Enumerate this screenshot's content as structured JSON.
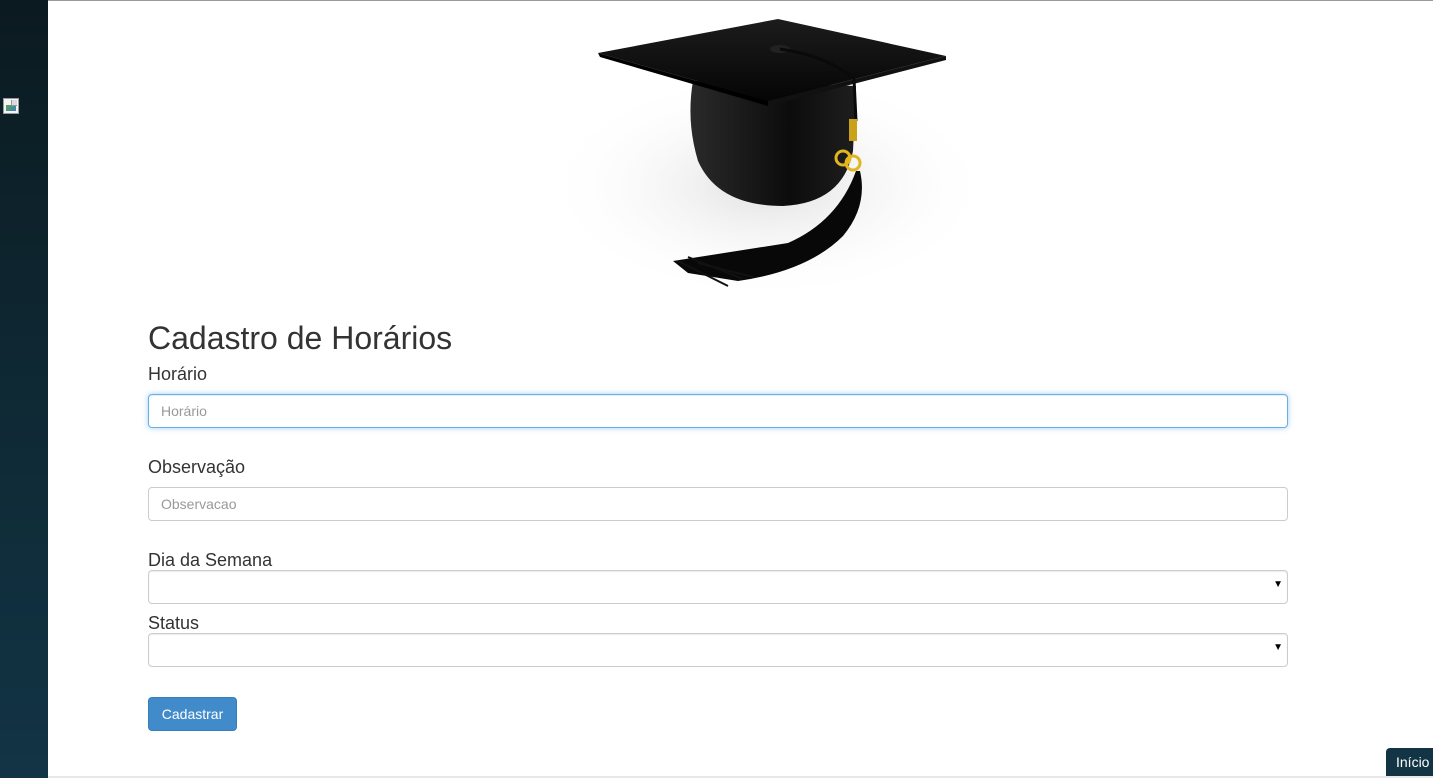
{
  "form": {
    "title": "Cadastro de Horários",
    "horario_label": "Horário",
    "horario_placeholder": "Horário",
    "observacao_label": "Observação",
    "observacao_placeholder": "Observacao",
    "dia_label": "Dia da Semana",
    "dia_value": "",
    "status_label": "Status",
    "status_value": "",
    "submit_label": "Cadastrar"
  },
  "footer": {
    "home_label": "Início"
  },
  "icons": {
    "hero": "graduation-cap-image",
    "broken": "broken-image-icon"
  },
  "colors": {
    "primary": "#428bca",
    "sidebar": "#123445",
    "focus": "#66afe9"
  }
}
